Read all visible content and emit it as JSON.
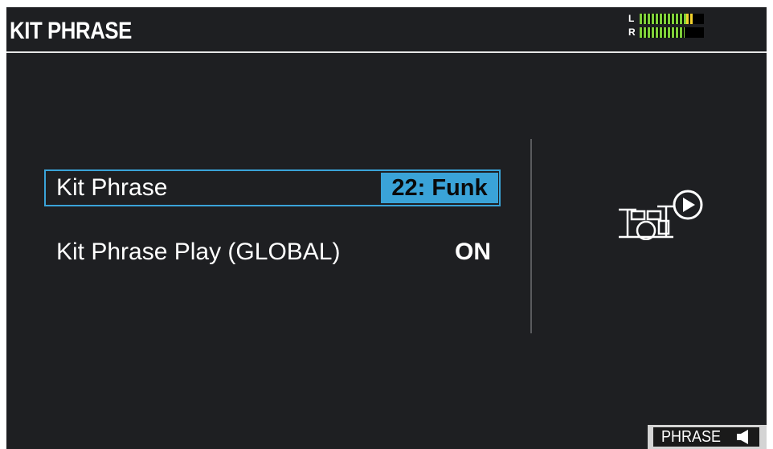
{
  "header": {
    "title": "KIT PHRASE",
    "meter": {
      "left_label": "L",
      "right_label": "R",
      "left_level": 0.82,
      "right_level": 0.7,
      "colors": {
        "level": "#7fcf3a",
        "peak": "#f2d12c"
      }
    }
  },
  "params": {
    "kit_phrase": {
      "label": "Kit Phrase",
      "value": "22: Funk"
    },
    "kit_phrase_play": {
      "label": "Kit Phrase Play (GLOBAL)",
      "value": "ON"
    }
  },
  "icons": {
    "kit_play": "drum-kit-play-icon",
    "speaker": "speaker-icon"
  },
  "footer": {
    "phrase_button": "PHRASE"
  },
  "colors": {
    "background": "#1e1f22",
    "accent": "#3aa3d8",
    "text": "#ffffff"
  }
}
